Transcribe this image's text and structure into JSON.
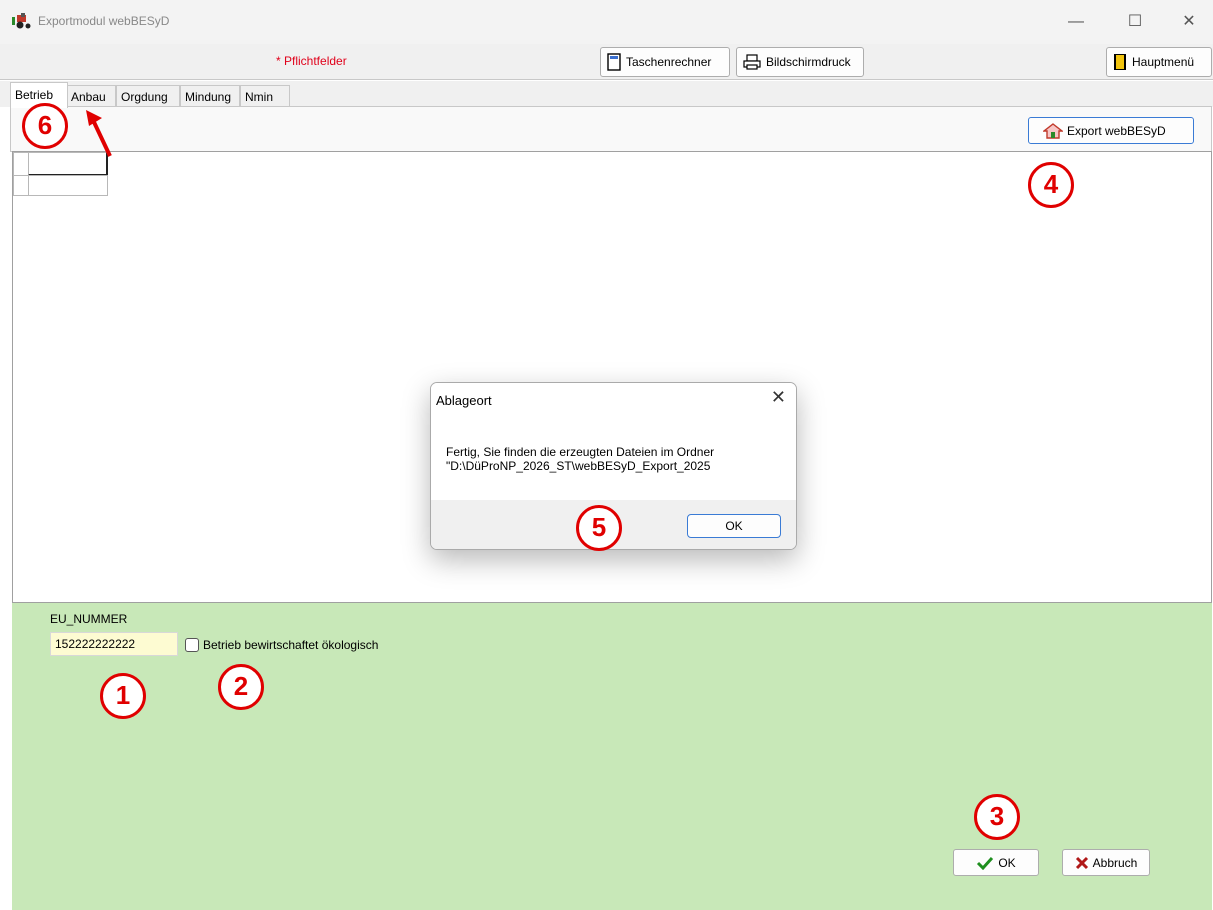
{
  "window": {
    "title": "Exportmodul webBESyD",
    "controls": {
      "minimize": "—",
      "maximize": "☐",
      "close": "✕"
    }
  },
  "toolbar": {
    "required_note": "* Pflichtfelder",
    "calculator_label": "Taschenrechner",
    "print_label": "Bildschirmdruck",
    "main_menu_label": "Hauptmenü"
  },
  "tabs": [
    {
      "label": "Betrieb",
      "active": true
    },
    {
      "label": "Anbau",
      "active": false
    },
    {
      "label": "Orgdung",
      "active": false
    },
    {
      "label": "Mindung",
      "active": false
    },
    {
      "label": "Nmin",
      "active": false
    }
  ],
  "export": {
    "label": "Export webBESyD"
  },
  "form": {
    "eu_label": "EU_NUMMER",
    "eu_value": "152222222222",
    "organic_label": "Betrieb bewirtschaftet ökologisch",
    "organic_checked": false
  },
  "actions": {
    "ok_label": "OK",
    "cancel_label": "Abbruch"
  },
  "dialog": {
    "title": "Ablageort",
    "message_line1": "Fertig, Sie finden die erzeugten Dateien im Ordner",
    "message_line2": "\"D:\\DüProNP_2026_ST\\webBESyD_Export_2025",
    "ok_label": "OK"
  },
  "markers": [
    "1",
    "2",
    "3",
    "4",
    "5",
    "6"
  ],
  "colors": {
    "accent": "#3a7bd5",
    "required": "#e00000",
    "form_bg": "#c8e8b8",
    "input_bg": "#fdfbd2"
  }
}
